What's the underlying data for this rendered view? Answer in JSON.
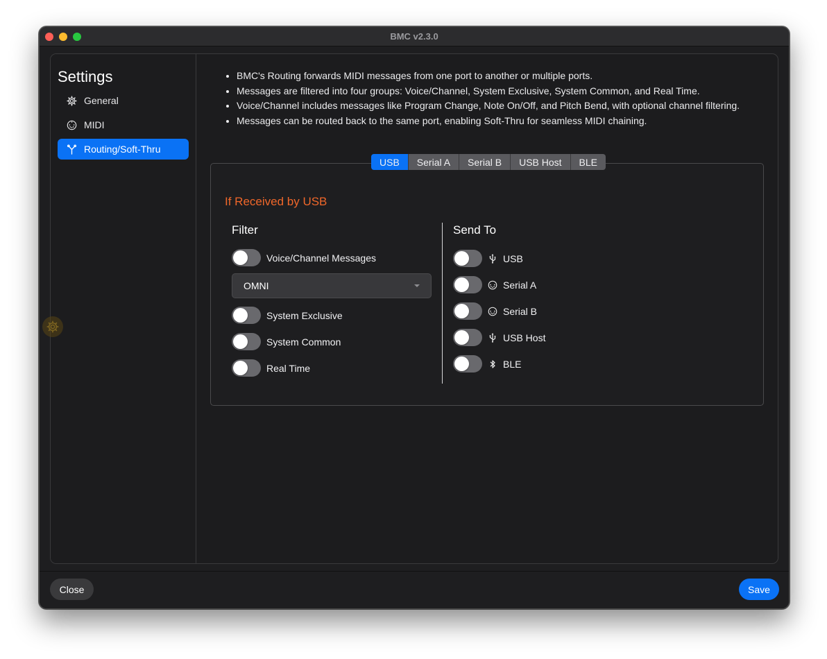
{
  "window": {
    "title": "BMC v2.3.0"
  },
  "sidebar": {
    "title": "Settings",
    "items": [
      {
        "label": "General",
        "icon": "gear-icon",
        "active": false
      },
      {
        "label": "MIDI",
        "icon": "midi-port-icon",
        "active": false
      },
      {
        "label": "Routing/Soft-Thru",
        "icon": "routing-icon",
        "active": true
      }
    ]
  },
  "notes": [
    "BMC's Routing forwards MIDI messages from one port to another or multiple ports.",
    "Messages are filtered into four groups: Voice/Channel, System Exclusive, System Common, and Real Time.",
    "Voice/Channel includes messages like Program Change, Note On/Off, and Pitch Bend, with optional channel filtering.",
    "Messages can be routed back to the same port, enabling Soft-Thru for seamless MIDI chaining."
  ],
  "tabs": [
    {
      "label": "USB",
      "active": true
    },
    {
      "label": "Serial A",
      "active": false
    },
    {
      "label": "Serial B",
      "active": false
    },
    {
      "label": "USB Host",
      "active": false
    },
    {
      "label": "BLE",
      "active": false
    }
  ],
  "routing": {
    "heading": "If Received by USB",
    "filter": {
      "title": "Filter",
      "voice_channel": {
        "label": "Voice/Channel Messages",
        "on": false
      },
      "channel_select": {
        "value": "OMNI"
      },
      "sysex": {
        "label": "System Exclusive",
        "on": false
      },
      "system_common": {
        "label": "System Common",
        "on": false
      },
      "real_time": {
        "label": "Real Time",
        "on": false
      }
    },
    "send_to": {
      "title": "Send To",
      "ports": [
        {
          "label": "USB",
          "icon": "usb-icon",
          "on": false
        },
        {
          "label": "Serial A",
          "icon": "midi-port-icon",
          "on": false
        },
        {
          "label": "Serial B",
          "icon": "midi-port-icon",
          "on": false
        },
        {
          "label": "USB Host",
          "icon": "usb-icon",
          "on": false
        },
        {
          "label": "BLE",
          "icon": "bluetooth-icon",
          "on": false
        }
      ]
    }
  },
  "footer": {
    "close_label": "Close",
    "save_label": "Save"
  },
  "colors": {
    "accent": "#0a72f5",
    "heading_orange": "#f0672a",
    "background": "#1c1c1e"
  }
}
